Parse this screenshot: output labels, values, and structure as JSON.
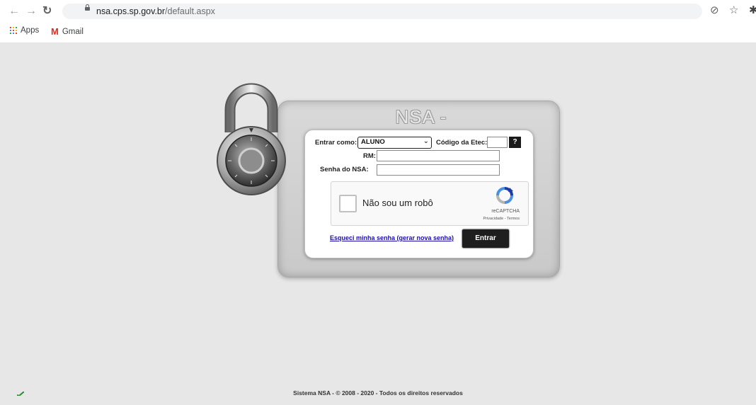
{
  "browser": {
    "url_host": "nsa.cps.sp.gov.br",
    "url_path": "/default.aspx",
    "bookmarks": [
      {
        "label": "Apps",
        "icon": "apps-grid-icon"
      },
      {
        "label": "Gmail",
        "icon": "gmail-icon"
      }
    ]
  },
  "login": {
    "title": "NSA - ONLINE",
    "entrar_como_label": "Entrar como:",
    "entrar_como_value": "ALUNO",
    "codigo_label": "Código da Etec:",
    "codigo_value": "",
    "help_label": "?",
    "rm_label": "RM:",
    "rm_value": "",
    "senha_label": "Senha do NSA:",
    "senha_value": "",
    "captcha_label": "Não sou um robô",
    "captcha_brand": "reCAPTCHA",
    "captcha_links": "Privacidade - Termos",
    "forgot_link": "Esqueci minha senha (gerar nova senha)",
    "submit_label": "Entrar"
  },
  "footer": {
    "text": "Sistema NSA  -  © 2008 - 2020  -  Todos os direitos reservados"
  },
  "colors": {
    "page_bg": "#e7e7e7",
    "button_bg": "#1e1e1e",
    "link": "#1a0dab"
  }
}
